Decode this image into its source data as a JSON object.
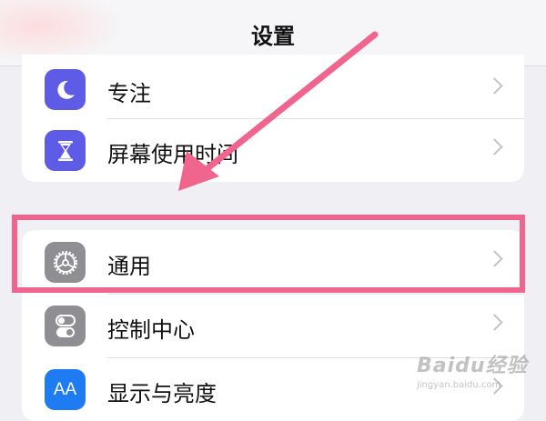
{
  "header": {
    "title": "设置"
  },
  "group1": {
    "items": [
      {
        "label": "专注",
        "icon": "moon-icon",
        "color": "#5e5ce6"
      },
      {
        "label": "屏幕使用时间",
        "icon": "hourglass-icon",
        "color": "#5e5ce6"
      }
    ]
  },
  "group2": {
    "items": [
      {
        "label": "通用",
        "icon": "gear-icon",
        "color": "#8e8e93"
      },
      {
        "label": "控制中心",
        "icon": "toggles-icon",
        "color": "#8e8e93"
      },
      {
        "label": "显示与亮度",
        "icon": "text-size-icon",
        "icon_text": "AA",
        "color": "#1e7bf2"
      }
    ]
  },
  "annotation": {
    "highlight_color": "#f0658e"
  },
  "watermark": {
    "brand": "Baidu经验",
    "url": "jingyan.baidu.com"
  }
}
